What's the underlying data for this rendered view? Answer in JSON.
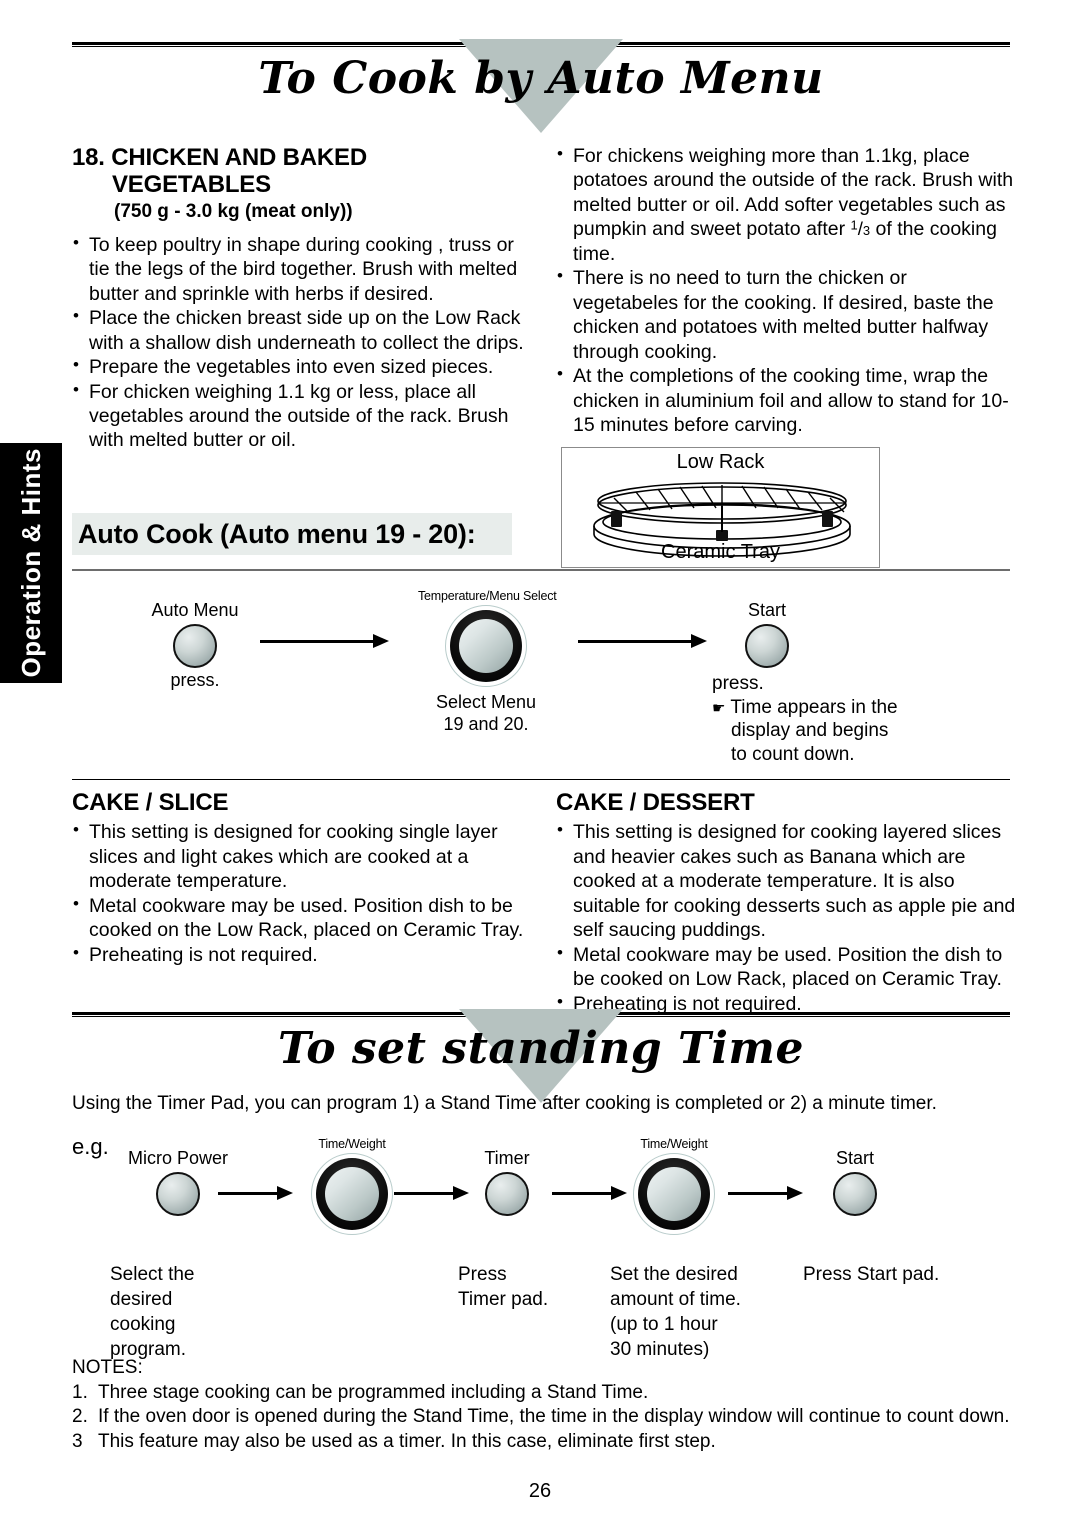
{
  "sidebar": {
    "tab_label": "Operation & Hints"
  },
  "section_auto": {
    "banner_title": "To Cook by  Auto Menu",
    "heading_line1": "18. CHICKEN AND BAKED",
    "heading_line2": "VEGETABLES",
    "subhead": "(750 g - 3.0 kg (meat only))",
    "left_bullets": [
      "To keep poultry in shape during cooking , truss or tie the legs of the bird together. Brush with melted butter and sprinkle with herbs if desired.",
      "Place the chicken breast side up on the Low Rack with a shallow dish underneath to collect the drips.",
      "Prepare the vegetables into even sized pieces.",
      "For chicken weighing 1.1 kg or less, place all vegetables around the outside of the rack. Brush with melted butter or oil."
    ],
    "right_bullet_1a": "For chickens weighing more than 1.1kg, place potatoes around the outside of the rack. Brush with melted butter or oil. Add softer vegetables such as pumpkin and sweet potato after ",
    "right_bullet_1_frac_num": "1",
    "right_bullet_1_frac_den": "3",
    "right_bullet_1b": " of the cooking time.",
    "right_bullets_rest": [
      "There is no need to turn the chicken or vegetabeles for the cooking. If desired, baste the chicken and potatoes with melted butter halfway through cooking.",
      "At the completions of the cooking time, wrap the chicken in aluminium foil and allow to stand for 10-15 minutes before carving."
    ]
  },
  "lowrack_figure": {
    "top_label": "Low Rack",
    "bottom_label": "Ceramic Tray"
  },
  "auto_cook": {
    "band_heading": "Auto Cook (Auto menu 19 - 20):",
    "step1_label": "Auto Menu",
    "step1_caption": "press.",
    "step2_label": "Temperature/Menu Select",
    "step2_caption_line1": "Select Menu",
    "step2_caption_line2": "19 and 20.",
    "step3_label": "Start",
    "step3_caption_line1": "press.",
    "step3_hand": "☛",
    "step3_caption_line2": "Time appears in the",
    "step3_caption_line3": "display and  begins",
    "step3_caption_line4": "to count down."
  },
  "cake_slice": {
    "heading": "CAKE / SLICE",
    "bullets": [
      "This setting is designed for cooking single layer slices and light cakes which are cooked at a moderate temperature.",
      "Metal cookware may be used. Position dish to be cooked on the Low Rack, placed on Ceramic Tray.",
      "Preheating is not required."
    ]
  },
  "cake_dessert": {
    "heading": "CAKE / DESSERT",
    "bullets": [
      "This setting is designed for cooking layered slices and heavier cakes such as Banana which are cooked at a moderate temperature. It is also suitable for cooking desserts such as apple pie and self saucing puddings.",
      "Metal cookware may be used. Position the dish to be cooked on Low Rack, placed on Ceramic Tray.",
      "Preheating is not required."
    ]
  },
  "section_standing": {
    "banner_title": "To set standing Time",
    "intro": "Using the Timer Pad, you can program  1) a Stand Time after cooking is completed or  2) a minute timer.",
    "eg_label": "e.g.",
    "steps": [
      {
        "label": "Micro Power",
        "type": "button"
      },
      {
        "label": "Time/Weight",
        "type": "knob"
      },
      {
        "label": "Timer",
        "type": "button"
      },
      {
        "label": "Time/Weight",
        "type": "knob"
      },
      {
        "label": "Start",
        "type": "button"
      }
    ],
    "captions": [
      "Select the\ndesired\ncooking\nprogram.",
      "Press\nTimer pad.",
      "Set the desired\namount of time.\n(up to 1 hour\n30 minutes)",
      "Press Start pad."
    ],
    "notes_heading": "NOTES:",
    "notes": [
      {
        "num": "1.",
        "text": "Three stage cooking can be programmed including a Stand Time."
      },
      {
        "num": "2.",
        "text": "If the oven door is opened during the Stand Time, the time in the display window will continue to count down."
      },
      {
        "num": "3",
        "text": "This feature may also be used as a timer. In this case, eliminate first step."
      }
    ]
  },
  "page_number": "26",
  "colors": {
    "banner_triangle": "#b6c2c0",
    "band_background": "#e8edeb",
    "tab_background": "#000000"
  }
}
